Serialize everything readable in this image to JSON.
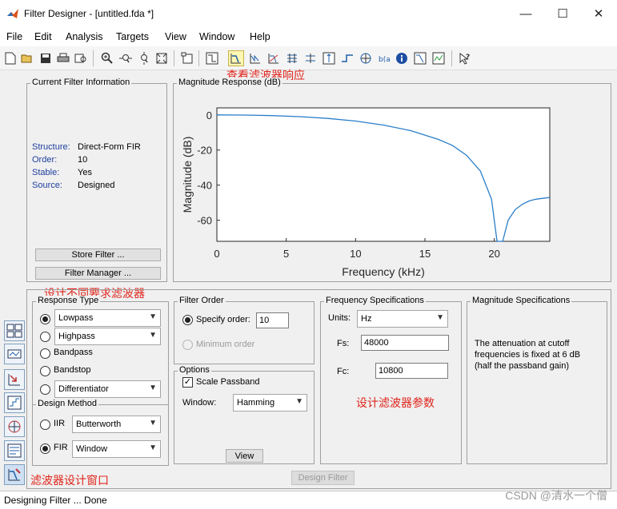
{
  "window": {
    "title": "Filter Designer -  [untitled.fda *]",
    "controls": {
      "minimize": "—",
      "maximize": "☐",
      "close": "✕"
    }
  },
  "menu": [
    "File",
    "Edit",
    "Analysis",
    "Targets",
    "View",
    "Window",
    "Help"
  ],
  "annotations": {
    "magnitude_view": "查看滤波器响应",
    "design_filters": "设计不同要求滤波器",
    "design_params": "设计滤波器参数",
    "design_window": "滤波器设计窗口"
  },
  "current_filter": {
    "title": "Current Filter Information",
    "rows": [
      {
        "label": "Structure:",
        "value": "Direct-Form FIR"
      },
      {
        "label": "Order:",
        "value": "10"
      },
      {
        "label": "Stable:",
        "value": "Yes"
      },
      {
        "label": "Source:",
        "value": "Designed"
      }
    ],
    "store_button": "Store Filter ...",
    "manager_button": "Filter Manager ..."
  },
  "plot": {
    "title": "Magnitude Response (dB)",
    "color": "#2b7ec8"
  },
  "chart_data": {
    "type": "line",
    "title": "Magnitude Response (dB)",
    "xlabel": "Frequency (kHz)",
    "ylabel": "Magnitude (dB)",
    "xlim": [
      0,
      24
    ],
    "ylim": [
      -72,
      4
    ],
    "xticks": [
      0,
      5,
      10,
      15,
      20
    ],
    "yticks": [
      0,
      -20,
      -40,
      -60
    ],
    "grid": false,
    "series": [
      {
        "x": [
          0,
          2,
          4,
          6,
          8,
          10,
          12,
          14,
          16,
          17,
          18,
          19,
          19.8,
          20.2,
          20.6,
          21,
          21.5,
          22,
          22.5,
          23,
          23.5,
          24
        ],
        "y": [
          0,
          -0.1,
          -0.4,
          -1,
          -2,
          -3.5,
          -5.8,
          -9,
          -14,
          -17.5,
          -23,
          -32,
          -48,
          -72,
          -72,
          -60,
          -54,
          -51,
          -49,
          -48,
          -47.5,
          -47
        ]
      }
    ]
  },
  "response_type": {
    "title": "Response Type",
    "options": [
      {
        "label": "Lowpass",
        "selected": true,
        "has_select": true,
        "select_value": "Lowpass"
      },
      {
        "label": "Highpass",
        "selected": false,
        "has_select": true,
        "select_value": "Highpass"
      },
      {
        "label": "Bandpass",
        "selected": false
      },
      {
        "label": "Bandstop",
        "selected": false
      },
      {
        "label": "Differentiator",
        "selected": false,
        "has_select": true,
        "select_value": "Differentiator"
      }
    ]
  },
  "design_method": {
    "title": "Design Method",
    "iir_label": "IIR",
    "iir_value": "Butterworth",
    "fir_label": "FIR",
    "fir_value": "Window"
  },
  "filter_order": {
    "title": "Filter Order",
    "specify_label": "Specify order:",
    "specify_value": "10",
    "minimum_label": "Minimum order"
  },
  "options": {
    "title": "Options",
    "scale_label": "Scale Passband",
    "window_label": "Window:",
    "window_value": "Hamming",
    "view_button": "View"
  },
  "freq_spec": {
    "title": "Frequency Specifications",
    "units_label": "Units:",
    "units_value": "Hz",
    "fs_label": "Fs:",
    "fs_value": "48000",
    "fc_label": "Fc:",
    "fc_value": "10800"
  },
  "mag_spec": {
    "title": "Magnitude Specifications",
    "text_1": "The attenuation at cutoff",
    "text_2": "frequencies is fixed at 6 dB",
    "text_3": "(half the passband gain)"
  },
  "design_button": "Design Filter",
  "status": "Designing Filter ... Done",
  "watermark": "CSDN @清水一个僧"
}
